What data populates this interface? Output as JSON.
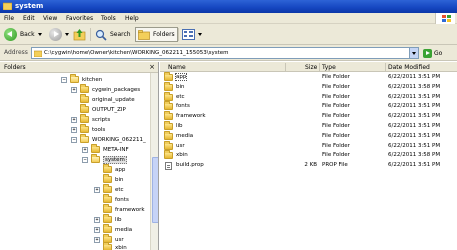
{
  "window": {
    "title": "system"
  },
  "menu": [
    "File",
    "Edit",
    "View",
    "Favorites",
    "Tools",
    "Help"
  ],
  "toolbar": {
    "back_label": "Back",
    "search_label": "Search",
    "folders_label": "Folders"
  },
  "address": {
    "label": "Address",
    "value": "C:\\cygwin\\home\\Owner\\kitchen\\WORKING_062211_155053\\system",
    "go_label": "Go"
  },
  "folders_pane": {
    "title": "Folders",
    "close": "×",
    "tree": [
      {
        "label": "kitchen",
        "expander": "−"
      },
      {
        "label": "cygwin_packages",
        "expander": "+"
      },
      {
        "label": "original_update",
        "expander": ""
      },
      {
        "label": "OUTPUT_ZIP",
        "expander": ""
      },
      {
        "label": "scripts",
        "expander": "+"
      },
      {
        "label": "tools",
        "expander": "+"
      },
      {
        "label": "WORKING_062211_",
        "expander": "−"
      },
      {
        "label": "META-INF",
        "expander": "+"
      },
      {
        "label": "system",
        "expander": "−"
      },
      {
        "label": "app",
        "expander": ""
      },
      {
        "label": "bin",
        "expander": ""
      },
      {
        "label": "etc",
        "expander": "+"
      },
      {
        "label": "fonts",
        "expander": ""
      },
      {
        "label": "framework",
        "expander": ""
      },
      {
        "label": "lib",
        "expander": "+"
      },
      {
        "label": "media",
        "expander": "+"
      },
      {
        "label": "usr",
        "expander": "+"
      },
      {
        "label": "xbin",
        "expander": ""
      }
    ]
  },
  "file_list": {
    "columns": [
      "Name",
      "Size",
      "Type",
      "Date Modified"
    ],
    "rows": [
      {
        "name": "app",
        "size": "",
        "type": "File Folder",
        "date": "6/22/2011 3:51 PM",
        "icon": "folder"
      },
      {
        "name": "bin",
        "size": "",
        "type": "File Folder",
        "date": "6/22/2011 3:58 PM",
        "icon": "folder"
      },
      {
        "name": "etc",
        "size": "",
        "type": "File Folder",
        "date": "6/22/2011 3:51 PM",
        "icon": "folder"
      },
      {
        "name": "fonts",
        "size": "",
        "type": "File Folder",
        "date": "6/22/2011 3:51 PM",
        "icon": "folder"
      },
      {
        "name": "framework",
        "size": "",
        "type": "File Folder",
        "date": "6/22/2011 3:51 PM",
        "icon": "folder"
      },
      {
        "name": "lib",
        "size": "",
        "type": "File Folder",
        "date": "6/22/2011 3:51 PM",
        "icon": "folder"
      },
      {
        "name": "media",
        "size": "",
        "type": "File Folder",
        "date": "6/22/2011 3:51 PM",
        "icon": "folder"
      },
      {
        "name": "usr",
        "size": "",
        "type": "File Folder",
        "date": "6/22/2011 3:51 PM",
        "icon": "folder"
      },
      {
        "name": "xbin",
        "size": "",
        "type": "File Folder",
        "date": "6/22/2011 3:58 PM",
        "icon": "folder"
      },
      {
        "name": "build.prop",
        "size": "2 KB",
        "type": "PROP File",
        "date": "6/22/2011 3:51 PM",
        "icon": "file"
      }
    ]
  }
}
